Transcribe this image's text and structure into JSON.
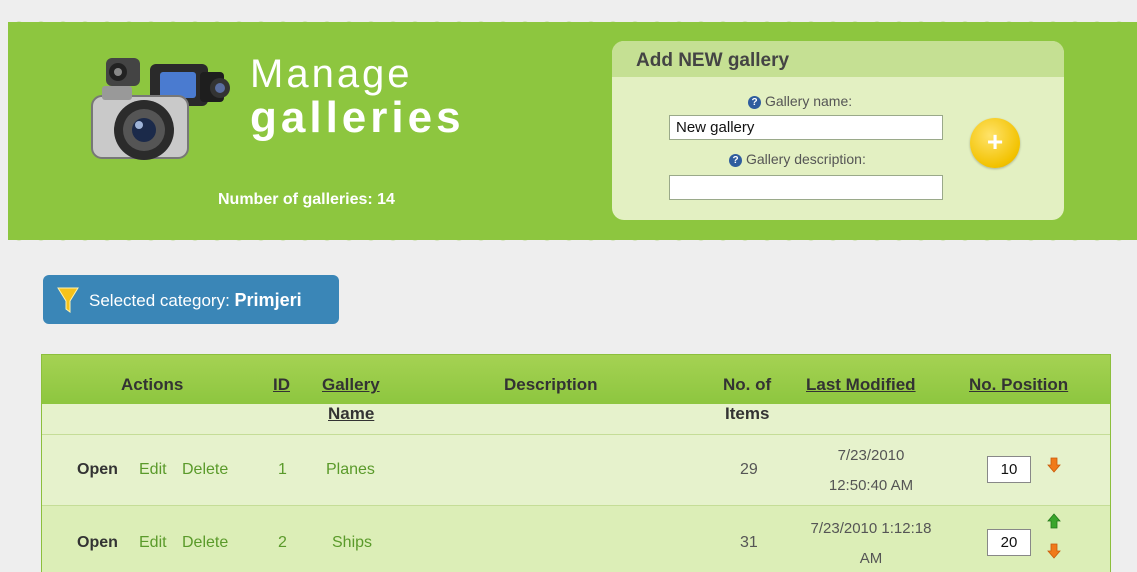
{
  "header": {
    "title_line1": "Manage",
    "title_line2": "galleries",
    "gallery_count_label": "Number of galleries: 14"
  },
  "add_panel": {
    "title": "Add NEW gallery",
    "name_label": "Gallery name:",
    "name_value": "New gallery",
    "description_label": "Gallery description:",
    "description_value": "",
    "add_button_symbol": "+"
  },
  "category": {
    "label": "Selected category:",
    "value": "Primjeri"
  },
  "table": {
    "columns": {
      "actions": "Actions",
      "id": "ID",
      "gallery_line1": "Gallery",
      "gallery_line2": "Name",
      "description": "Description",
      "items_line1": "No. of",
      "items_line2": "Items",
      "last_modified": "Last Modified",
      "position": "No. Position"
    },
    "rows": [
      {
        "open": "Open",
        "edit": "Edit",
        "delete": "Delete",
        "id": "1",
        "name": "Planes",
        "description": "",
        "items": "29",
        "date_line1": "7/23/2010",
        "date_line2": "12:50:40 AM",
        "position": "10",
        "has_up": false,
        "has_down": true
      },
      {
        "open": "Open",
        "edit": "Edit",
        "delete": "Delete",
        "id": "2",
        "name": "Ships",
        "description": "",
        "items": "31",
        "date_line1": "7/23/2010 1:12:18",
        "date_line2": "AM",
        "position": "20",
        "has_up": true,
        "has_down": true
      }
    ]
  },
  "colors": {
    "header_green": "#8dc63f",
    "panel_bg": "#e3f0c2",
    "category_blue": "#3a86b7",
    "add_button_yellow": "#f2c200",
    "arrow_up_green": "#3aa52c",
    "arrow_down_orange": "#f07a1a"
  },
  "icons": {
    "logo": "camera-collection-icon",
    "help": "help-icon",
    "add": "plus-icon",
    "category": "funnel-icon",
    "move_up": "arrow-up-icon",
    "move_down": "arrow-down-icon"
  }
}
